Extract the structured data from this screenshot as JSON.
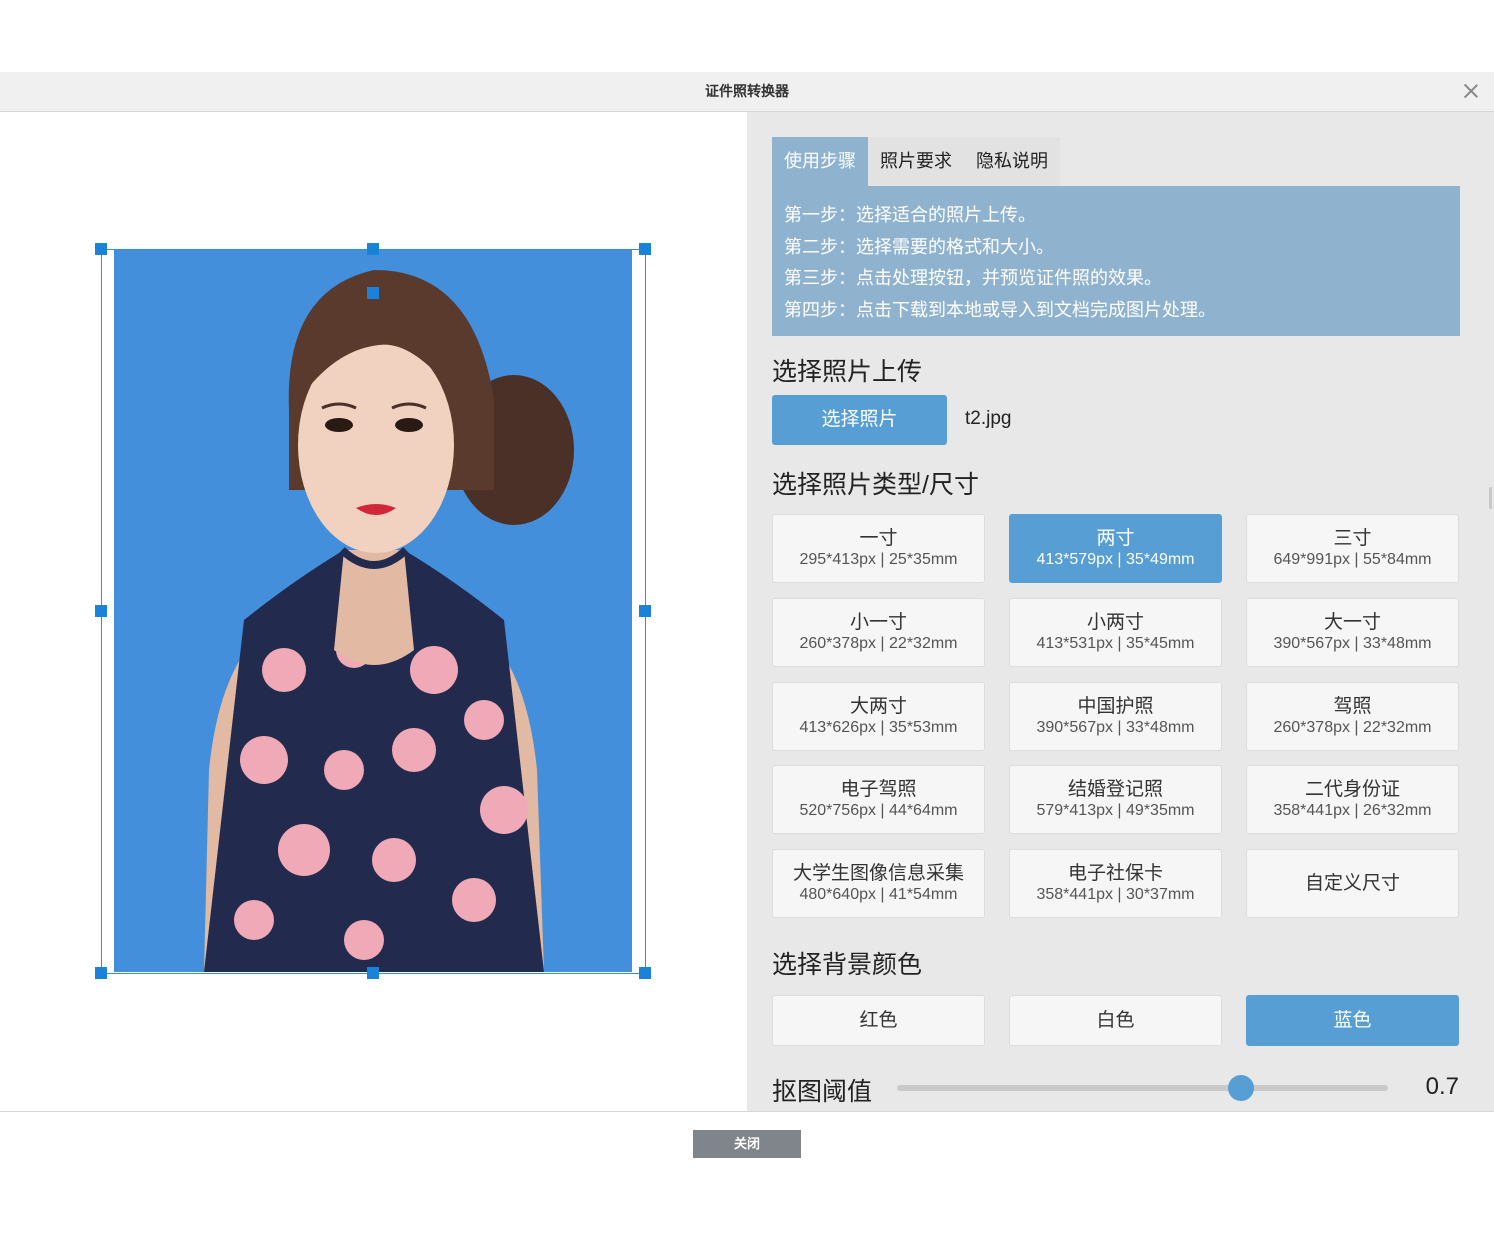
{
  "window": {
    "title": "证件照转换器"
  },
  "tabs": [
    {
      "label": "使用步骤",
      "active": true
    },
    {
      "label": "照片要求",
      "active": false
    },
    {
      "label": "隐私说明",
      "active": false
    }
  ],
  "steps": [
    "第一步：选择适合的照片上传。",
    "第二步：选择需要的格式和大小。",
    "第三步：点击处理按钮，并预览证件照的效果。",
    "第四步：点击下载到本地或导入到文档完成图片处理。"
  ],
  "upload": {
    "heading": "选择照片上传",
    "button": "选择照片",
    "file_name": "t2.jpg"
  },
  "sizes": {
    "heading": "选择照片类型/尺寸",
    "items": [
      {
        "name": "一寸",
        "dims": "295*413px | 25*35mm"
      },
      {
        "name": "两寸",
        "dims": "413*579px | 35*49mm",
        "selected": true
      },
      {
        "name": "三寸",
        "dims": "649*991px | 55*84mm"
      },
      {
        "name": "小一寸",
        "dims": "260*378px | 22*32mm"
      },
      {
        "name": "小两寸",
        "dims": "413*531px | 35*45mm"
      },
      {
        "name": "大一寸",
        "dims": "390*567px | 33*48mm"
      },
      {
        "name": "大两寸",
        "dims": "413*626px | 35*53mm"
      },
      {
        "name": "中国护照",
        "dims": "390*567px | 33*48mm"
      },
      {
        "name": "驾照",
        "dims": "260*378px | 22*32mm"
      },
      {
        "name": "电子驾照",
        "dims": "520*756px | 44*64mm"
      },
      {
        "name": "结婚登记照",
        "dims": "579*413px | 49*35mm"
      },
      {
        "name": "二代身份证",
        "dims": "358*441px | 26*32mm"
      },
      {
        "name": "大学生图像信息采集",
        "dims": "480*640px | 41*54mm"
      },
      {
        "name": "电子社保卡",
        "dims": "358*441px | 30*37mm"
      },
      {
        "name": "自定义尺寸",
        "dims": ""
      }
    ]
  },
  "background": {
    "heading": "选择背景颜色",
    "options": [
      {
        "label": "红色"
      },
      {
        "label": "白色"
      },
      {
        "label": "蓝色",
        "selected": true
      }
    ],
    "photo_color": "#448fdb"
  },
  "threshold": {
    "label": "抠图阈值",
    "value": "0.7",
    "fraction": 0.7
  },
  "footer": {
    "close_label": "关闭"
  },
  "colors": {
    "accent": "#569ed4",
    "tab_panel": "#8fb3cf",
    "panel_bg": "#e8e8e8"
  }
}
